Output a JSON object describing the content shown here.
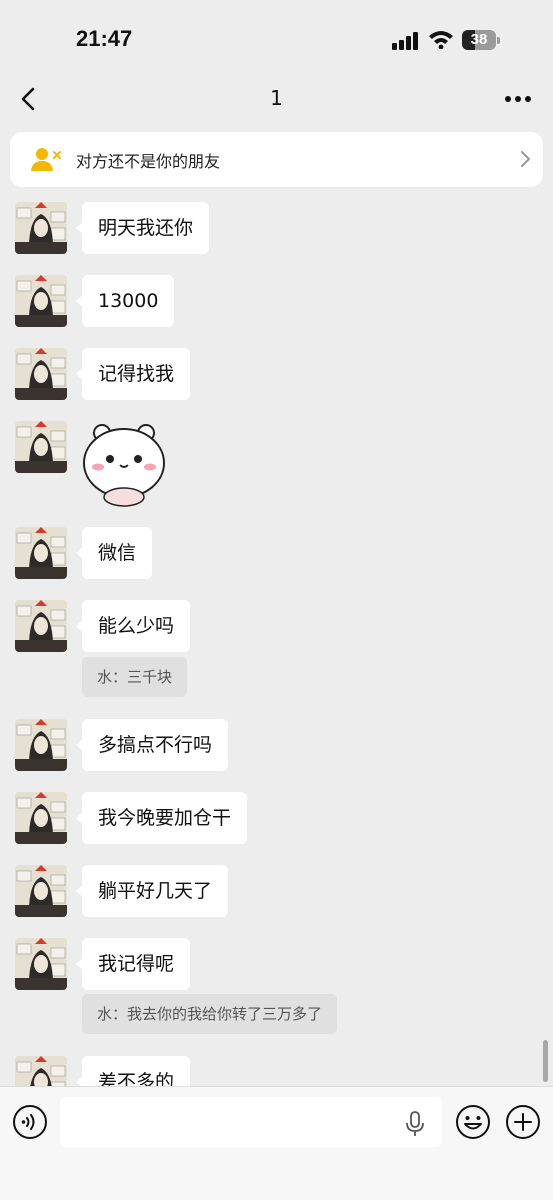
{
  "status": {
    "time": "21:47",
    "battery": "38"
  },
  "nav": {
    "title": "1",
    "back_icon": "chevron-left-icon",
    "more_icon": "more-dots-icon"
  },
  "banner": {
    "text": "对方还不是你的朋友",
    "icon": "add-friend-icon"
  },
  "messages": [
    {
      "text": "明天我还你"
    },
    {
      "text": "13000"
    },
    {
      "text": "记得找我"
    },
    {
      "sticker": "bear-sticker-icon"
    },
    {
      "text": "微信"
    },
    {
      "text": "能么少吗",
      "quote": "水：三千块"
    },
    {
      "text": "多搞点不行吗"
    },
    {
      "text": "我今晚要加仓干"
    },
    {
      "text": "躺平好几天了"
    },
    {
      "text": "我记得呢",
      "quote": "水：我去你的我给你转了三万多了"
    },
    {
      "text": "差不多的"
    }
  ],
  "input": {
    "placeholder": ""
  },
  "colors": {
    "background": "#ededed",
    "bubble": "#ffffff",
    "quote": "#e0e0e0"
  }
}
